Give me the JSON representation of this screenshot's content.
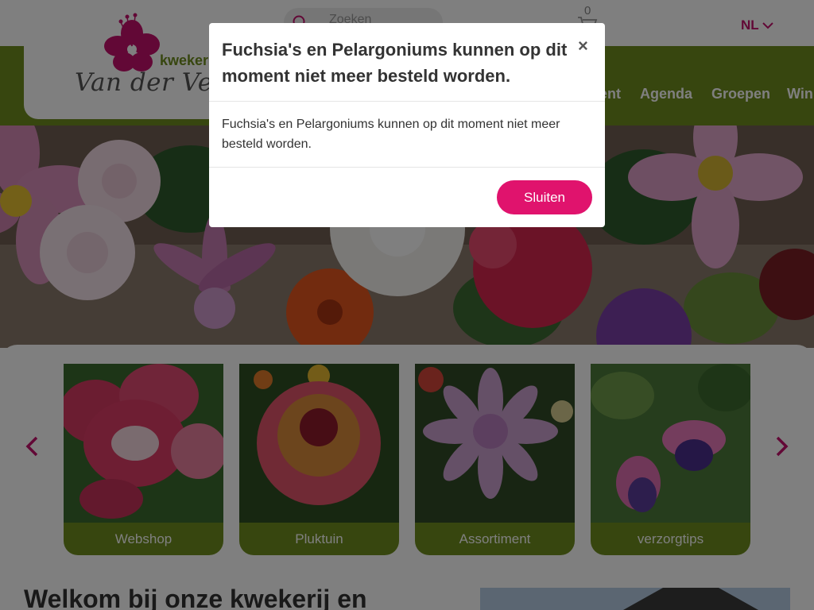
{
  "header": {
    "logo_wordmark": "kwekerij",
    "logo_name": "Van der Velde",
    "search_placeholder": "Zoeken",
    "cart_count": "0",
    "language": "NL"
  },
  "nav": {
    "items": [
      "...ent",
      "Agenda",
      "Groepen",
      "Win..."
    ],
    "visible_labels": [
      "ent",
      "Agenda",
      "Groepen",
      "Win"
    ]
  },
  "categories": [
    {
      "label": "Webshop",
      "photo": "pink-white-pelargonium"
    },
    {
      "label": "Pluktuin",
      "photo": "orange-zinnia"
    },
    {
      "label": "Assortiment",
      "photo": "lilac-cactus-dahlia"
    },
    {
      "label": "verzorgtips",
      "photo": "purple-pink-fuchsia"
    }
  ],
  "welcome": {
    "heading": "Welkom bij onze kwekerij en"
  },
  "modal": {
    "title": "Fuchsia's en Pelargoniums kunnen op dit moment niet meer besteld worden.",
    "body": "Fuchsia's en Pelargoniums kunnen op dit moment niet meer besteld worden.",
    "close_symbol": "×",
    "button_label": "Sluiten"
  },
  "colors": {
    "brand_green": "#6e8d1f",
    "brand_pink": "#c4116c",
    "button_pink": "#e0136d"
  }
}
